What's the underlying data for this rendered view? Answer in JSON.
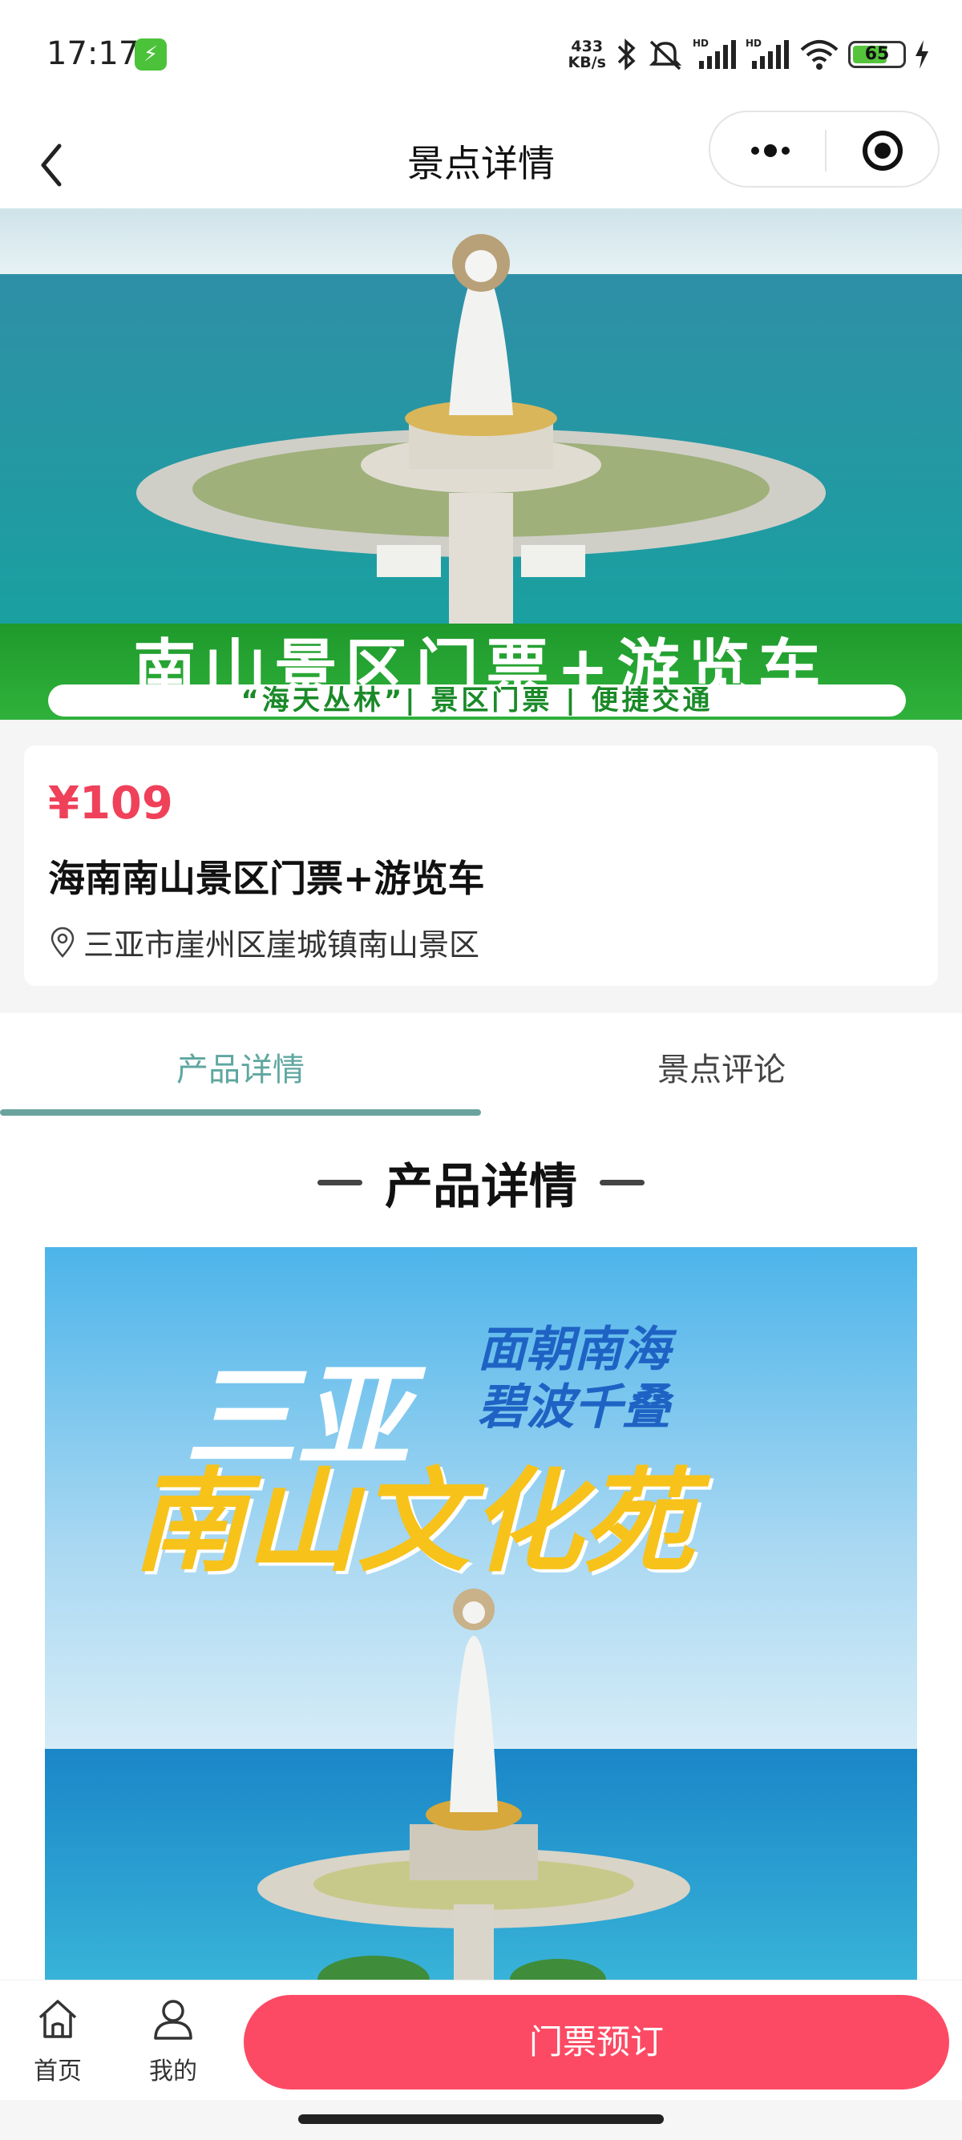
{
  "status_bar": {
    "time": "17:17",
    "net_speed_value": "433",
    "net_speed_unit": "KB/s",
    "battery_level": "65",
    "icons": [
      "charging-icon",
      "bluetooth-icon",
      "mute-icon",
      "signal-hd-icon",
      "signal-hd-icon",
      "wifi-icon",
      "battery-icon",
      "bolt-icon"
    ]
  },
  "nav": {
    "title": "景点详情"
  },
  "hero": {
    "banner_title": "南山景区门票+游览车",
    "banner_subtitle": "“海天丛林”| 景区门票 | 便捷交通"
  },
  "product": {
    "price": "¥109",
    "title": "海南南山景区门票+游览车",
    "address": "三亚市崖州区崖城镇南山景区"
  },
  "tabs": [
    {
      "label": "产品详情",
      "active": true
    },
    {
      "label": "景点评论",
      "active": false
    }
  ],
  "detail": {
    "section_title": "产品详情",
    "poster": {
      "line1": "三亚",
      "slogan_1": "面朝南海",
      "slogan_2": "碧波千叠",
      "line2": "南山文化苑"
    }
  },
  "bottom_bar": {
    "home_label": "首页",
    "mine_label": "我的",
    "book_label": "门票预订"
  },
  "colors": {
    "accent": "#fd4a64",
    "price": "#f0415a",
    "tab_active": "#5fa7a0",
    "banner_green": "#2fb13b"
  }
}
